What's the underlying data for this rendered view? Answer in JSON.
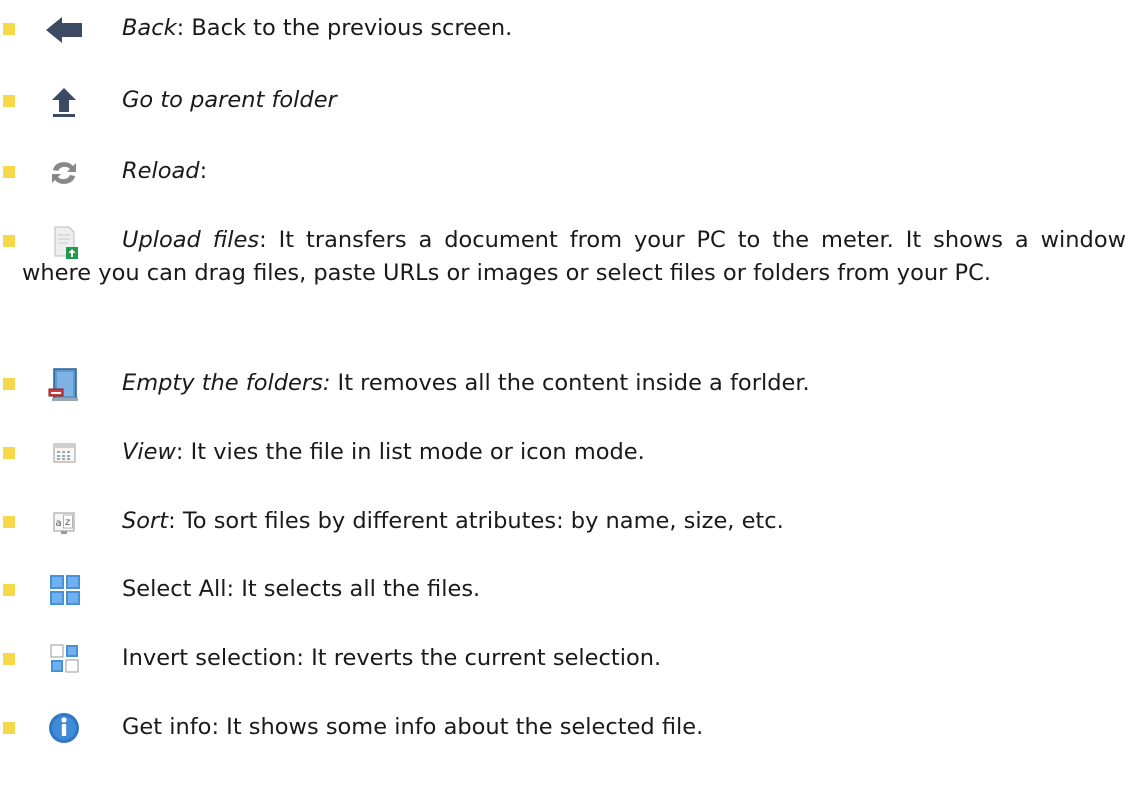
{
  "items": [
    {
      "term": "Back",
      "sep": ":",
      "desc": " Back to the previous screen.",
      "icon": "back-arrow-icon"
    },
    {
      "term": "Go to parent folder",
      "sep": "",
      "desc": "",
      "icon": "up-arrow-icon"
    },
    {
      "term": "Reload",
      "sep": ":",
      "desc": "",
      "icon": "reload-icon"
    },
    {
      "term": "Upload files",
      "sep": ":",
      "desc": " It transfers a document from your PC to the meter. It shows a window where you can drag files, paste URLs or images or select files or folders from your PC.",
      "icon": "upload-file-icon"
    },
    {
      "term": "Empty the folders:",
      "sep": "",
      "desc": " It removes all the content inside a forlder.",
      "icon": "empty-folder-icon"
    },
    {
      "term": "View",
      "sep": ":",
      "desc": " It vies the file in list mode or icon mode.",
      "icon": "view-icon"
    },
    {
      "term": "Sort",
      "sep": ":",
      "desc": " To sort files by different atributes: by name, size, etc.",
      "icon": "sort-icon"
    },
    {
      "plain": "Select All: It selects all the files.",
      "icon": "select-all-icon"
    },
    {
      "plain": "Invert selection: It reverts the current selection.",
      "icon": "invert-selection-icon"
    },
    {
      "plain": "Get info: It shows some info about the selected file.",
      "icon": "info-icon"
    }
  ],
  "colors": {
    "bullet": "#f5d94a",
    "text": "#1a1a1a",
    "icon_blue": "#4a90d9",
    "icon_dark": "#3c4b63"
  }
}
